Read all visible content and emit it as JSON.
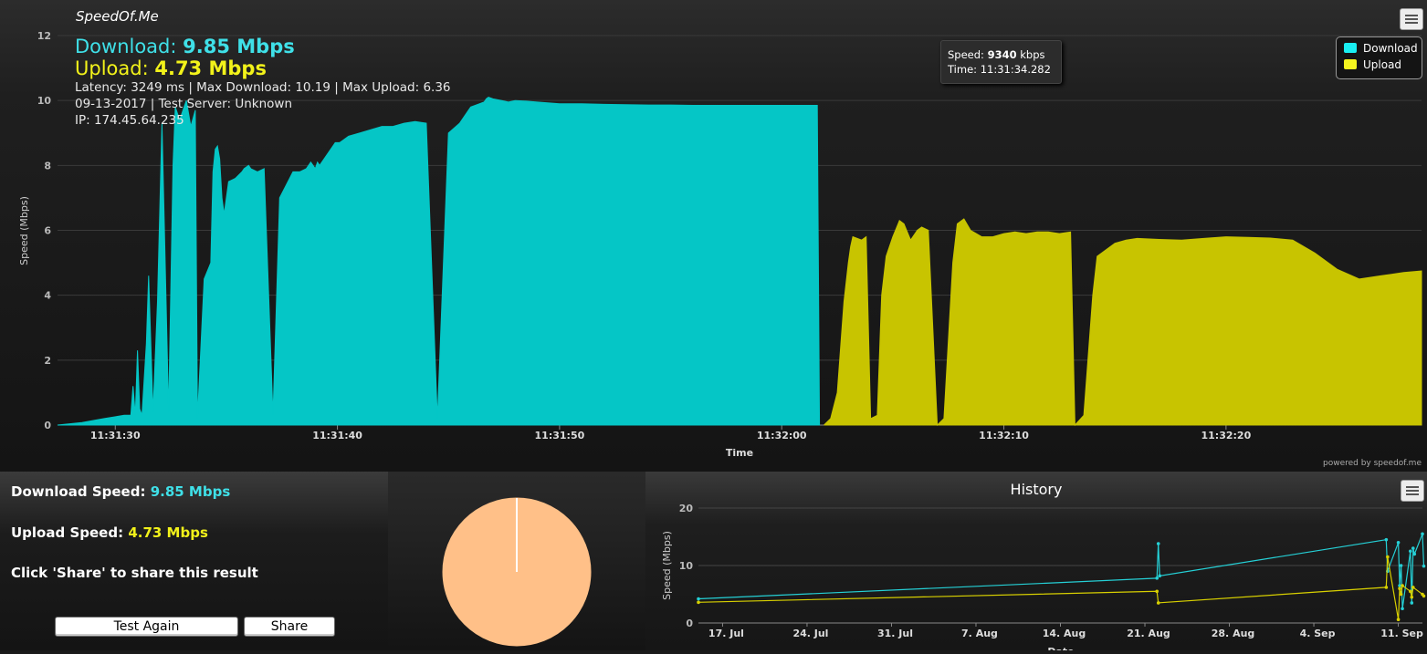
{
  "app": {
    "brand": "SpeedOf.Me"
  },
  "summary": {
    "download_label": "Download:",
    "download_value": "9.85 Mbps",
    "upload_label": "Upload:",
    "upload_value": "4.73 Mbps",
    "meta_line1": "Latency: 3249 ms | Max Download: 10.19 | Max Upload: 6.36",
    "meta_line2": "09-13-2017 | Test Server: Unknown",
    "meta_line3": "IP: 174.45.64.235"
  },
  "tooltip": {
    "speed_label": "Speed:",
    "speed_value": "9340",
    "speed_unit": "kbps",
    "time_label": "Time:",
    "time_value": "11:31:34.282"
  },
  "powered_by": "powered by speedof.me",
  "colors": {
    "download": "#05c6c6",
    "upload": "#c8c400",
    "download_text": "#3fe0e8",
    "upload_text": "#f2f21a",
    "history_download": "#25d0d6",
    "history_upload": "#d8d000",
    "pie": "#ffc088"
  },
  "bottom": {
    "download_label": "Download Speed:",
    "download_value": "9.85 Mbps",
    "upload_label": "Upload Speed:",
    "upload_value": "4.73 Mbps",
    "share_hint": "Click 'Share' to share this result",
    "test_again_label": "Test Again",
    "share_label": "Share"
  },
  "chart_data": [
    {
      "type": "area",
      "title": "",
      "xlabel": "Time",
      "ylabel": "Speed (Mbps)",
      "ylim": [
        0,
        12
      ],
      "yticks": [
        0,
        2,
        4,
        6,
        8,
        10,
        12
      ],
      "xlim": [
        "11:31:27.4",
        "11:32:28.8"
      ],
      "xticks": [
        "11:31:30",
        "11:31:40",
        "11:31:50",
        "11:32:00",
        "11:32:10",
        "11:32:20"
      ],
      "grid": true,
      "legend": "top-right",
      "series": [
        {
          "name": "Download",
          "x": [
            "11:31:27.40",
            "11:31:28.50",
            "11:31:29.50",
            "11:31:30.40",
            "11:31:30.70",
            "11:31:30.80",
            "11:31:30.90",
            "11:31:31.00",
            "11:31:31.10",
            "11:31:31.20",
            "11:31:31.40",
            "11:31:31.50",
            "11:31:31.70",
            "11:31:31.90",
            "11:31:32.00",
            "11:31:32.10",
            "11:31:32.40",
            "11:31:32.60",
            "11:31:32.70",
            "11:31:32.80",
            "11:31:32.90",
            "11:31:33.20",
            "11:31:33.40",
            "11:31:33.60",
            "11:31:33.70",
            "11:31:34.00",
            "11:31:34.30",
            "11:31:34.40",
            "11:31:34.50",
            "11:31:34.60",
            "11:31:34.70",
            "11:31:34.80",
            "11:31:34.90",
            "11:31:35.10",
            "11:31:35.40",
            "11:31:35.70",
            "11:31:35.80",
            "11:31:36.00",
            "11:31:36.10",
            "11:31:36.40",
            "11:31:36.70",
            "11:31:37.10",
            "11:31:37.40",
            "11:31:38.00",
            "11:31:38.30",
            "11:31:38.60",
            "11:31:38.80",
            "11:31:39.00",
            "11:31:39.10",
            "11:31:39.20",
            "11:31:39.50",
            "11:31:39.70",
            "11:31:39.80",
            "11:31:39.90",
            "11:31:40.10",
            "11:31:40.30",
            "11:31:40.50",
            "11:31:41.00",
            "11:31:41.50",
            "11:31:42.00",
            "11:31:42.50",
            "11:31:43.00",
            "11:31:43.50",
            "11:31:44.00",
            "11:31:44.50",
            "11:31:45.00",
            "11:31:45.50",
            "11:31:46.00",
            "11:31:46.40",
            "11:31:46.60",
            "11:31:46.70",
            "11:31:46.80",
            "11:31:47.00",
            "11:31:47.40",
            "11:31:47.70",
            "11:31:48.00",
            "11:31:48.50",
            "11:31:49.00",
            "11:31:50.00",
            "11:31:51.00",
            "11:31:52.00",
            "11:31:53.00",
            "11:31:54.00",
            "11:31:55.00",
            "11:31:56.00",
            "11:31:57.00",
            "11:31:58.00",
            "11:31:59.00",
            "11:32:00.00",
            "11:32:01.00",
            "11:32:01.60",
            "11:32:01.70"
          ],
          "y": [
            0,
            0.08,
            0.2,
            0.3,
            0.3,
            1.2,
            0.3,
            2.3,
            0.5,
            0.3,
            2.5,
            4.6,
            0.4,
            3.8,
            6.5,
            9.3,
            0.4,
            8,
            9.8,
            9.6,
            9.4,
            10,
            9.2,
            9.7,
            0.2,
            4.5,
            5,
            7.8,
            8.5,
            8.6,
            8.2,
            7,
            6.5,
            7.5,
            7.6,
            7.8,
            7.9,
            8,
            7.9,
            7.8,
            7.9,
            0.3,
            7,
            7.8,
            7.8,
            7.9,
            8.1,
            7.9,
            8.1,
            8,
            8.3,
            8.5,
            8.6,
            8.7,
            8.7,
            8.8,
            8.9,
            9,
            9.1,
            9.2,
            9.2,
            9.3,
            9.35,
            9.3,
            0.2,
            9,
            9.3,
            9.8,
            9.9,
            9.95,
            10.05,
            10.1,
            10.05,
            10,
            9.95,
            10,
            9.98,
            9.95,
            9.9,
            9.9,
            9.88,
            9.87,
            9.86,
            9.86,
            9.85,
            9.85,
            9.85,
            9.85,
            9.85,
            9.85,
            9.85,
            0
          ]
        },
        {
          "name": "Upload",
          "x": [
            "11:32:01.90",
            "11:32:02.20",
            "11:32:02.50",
            "11:32:02.80",
            "11:32:03.00",
            "11:32:03.10",
            "11:32:03.20",
            "11:32:03.60",
            "11:32:03.80",
            "11:32:04.00",
            "11:32:04.30",
            "11:32:04.50",
            "11:32:04.70",
            "11:32:05.00",
            "11:32:05.30",
            "11:32:05.50",
            "11:32:05.80",
            "11:32:06.10",
            "11:32:06.30",
            "11:32:06.60",
            "11:32:07.00",
            "11:32:07.30",
            "11:32:07.70",
            "11:32:07.90",
            "11:32:08.20",
            "11:32:08.50",
            "11:32:09.00",
            "11:32:09.50",
            "11:32:10.00",
            "11:32:10.50",
            "11:32:11.00",
            "11:32:11.50",
            "11:32:12.00",
            "11:32:12.50",
            "11:32:13.00",
            "11:32:13.20",
            "11:32:13.60",
            "11:32:14.00",
            "11:32:14.20",
            "11:32:15.00",
            "11:32:15.50",
            "11:32:16.00",
            "11:32:17.00",
            "11:32:18.00",
            "11:32:19.00",
            "11:32:20.00",
            "11:32:21.00",
            "11:32:22.00",
            "11:32:23.00",
            "11:32:24.00",
            "11:32:25.00",
            "11:32:26.00",
            "11:32:27.00",
            "11:32:28.00",
            "11:32:28.80"
          ],
          "y": [
            0,
            0.2,
            1,
            3.8,
            5,
            5.5,
            5.8,
            5.7,
            5.8,
            0.2,
            0.3,
            4,
            5.2,
            5.8,
            6.3,
            6.2,
            5.7,
            6,
            6.1,
            6,
            0,
            0.2,
            5,
            6.2,
            6.35,
            6,
            5.8,
            5.8,
            5.9,
            5.95,
            5.9,
            5.95,
            5.95,
            5.9,
            5.95,
            0,
            0.3,
            4,
            5.2,
            5.6,
            5.7,
            5.75,
            5.72,
            5.7,
            5.75,
            5.8,
            5.78,
            5.76,
            5.7,
            5.3,
            4.8,
            4.5,
            4.6,
            4.7,
            4.75
          ]
        }
      ]
    },
    {
      "type": "pie",
      "title": "",
      "values": [
        99.5,
        0.5
      ],
      "colors": [
        "#ffc088",
        "#ffffff"
      ]
    },
    {
      "type": "line",
      "title": "History",
      "xlabel": "Date",
      "ylabel": "Speed (Mbps)",
      "ylim": [
        0,
        20
      ],
      "yticks": [
        0,
        10,
        20
      ],
      "xlim": [
        "2017-07-15",
        "2017-09-13"
      ],
      "xticks": [
        "17. Jul",
        "24. Jul",
        "31. Jul",
        "7. Aug",
        "14. Aug",
        "21. Aug",
        "28. Aug",
        "4. Sep",
        "11. Sep"
      ],
      "series": [
        {
          "name": "Download",
          "x": [
            "2017-07-15",
            "2017-08-22",
            "2017-08-22",
            "2017-08-22",
            "2017-09-10",
            "2017-09-10",
            "2017-09-11",
            "2017-09-11",
            "2017-09-11",
            "2017-09-11",
            "2017-09-12",
            "2017-09-12",
            "2017-09-12",
            "2017-09-12",
            "2017-09-13",
            "2017-09-13"
          ],
          "y": [
            4.2,
            7.8,
            13.8,
            8.2,
            14.5,
            9,
            14,
            6.5,
            10,
            2.5,
            12.5,
            3.5,
            13,
            12,
            15.5,
            9.9
          ]
        },
        {
          "name": "Upload",
          "x": [
            "2017-07-15",
            "2017-08-22",
            "2017-08-22",
            "2017-09-10",
            "2017-09-10",
            "2017-09-11",
            "2017-09-11",
            "2017-09-11",
            "2017-09-11",
            "2017-09-12",
            "2017-09-12",
            "2017-09-12",
            "2017-09-13",
            "2017-09-13"
          ],
          "y": [
            3.6,
            5.5,
            3.5,
            6.2,
            11.5,
            0.6,
            6,
            5,
            6.5,
            5.5,
            4.5,
            6.2,
            5,
            4.7
          ]
        }
      ]
    }
  ]
}
